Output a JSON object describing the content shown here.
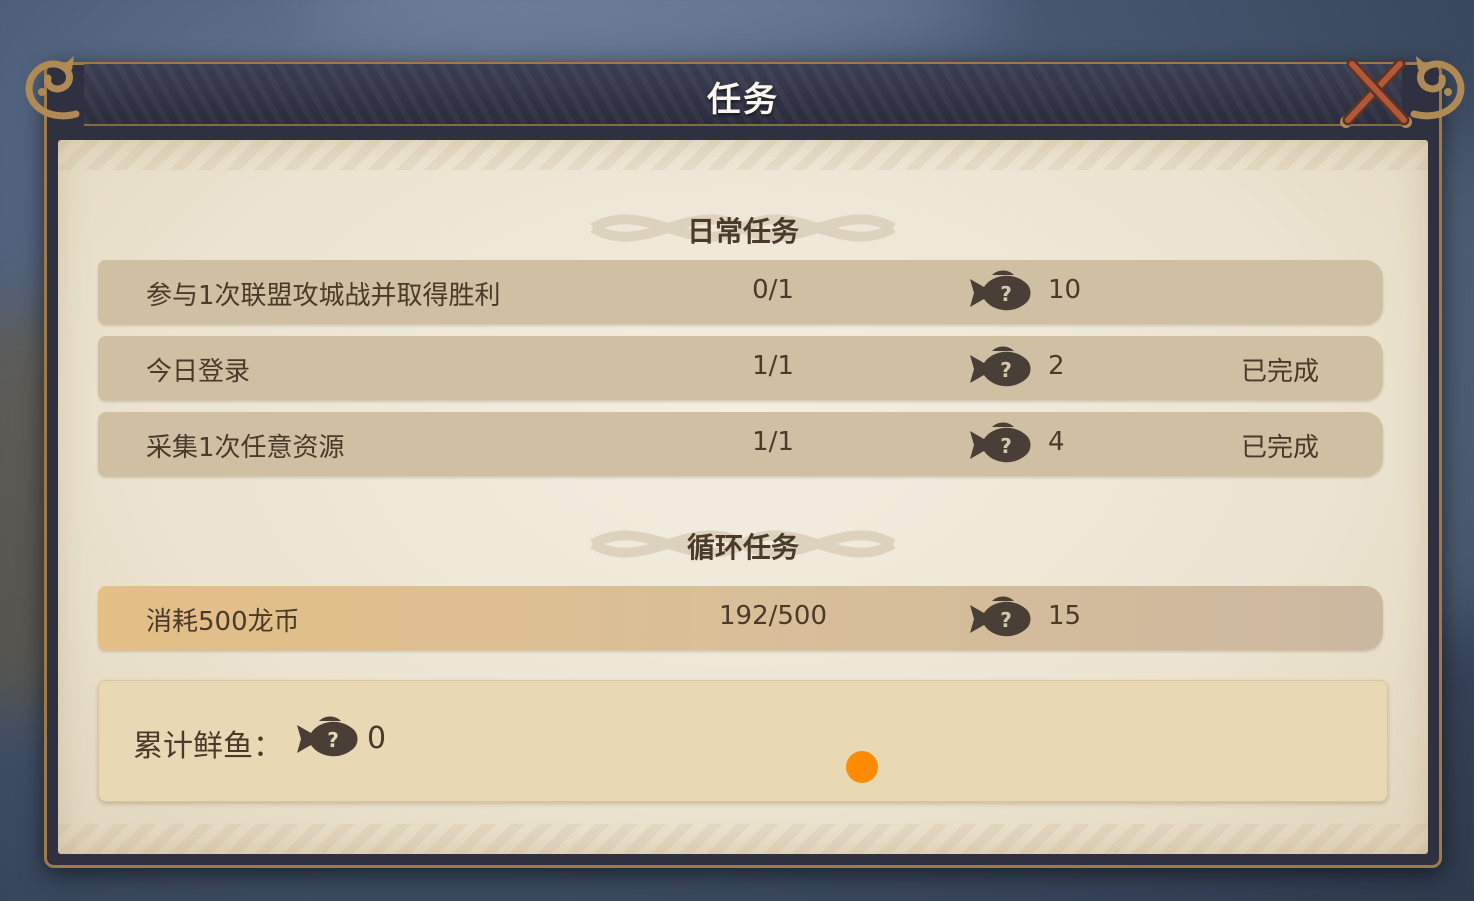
{
  "dialog": {
    "title": "任务"
  },
  "daily": {
    "header": "日常任务",
    "tasks": [
      {
        "name": "参与1次联盟攻城战并取得胜利",
        "progress": "0/1",
        "reward": "10",
        "status": ""
      },
      {
        "name": "今日登录",
        "progress": "1/1",
        "reward": "2",
        "status": "已完成"
      },
      {
        "name": "采集1次任意资源",
        "progress": "1/1",
        "reward": "4",
        "status": "已完成"
      }
    ]
  },
  "cycle": {
    "header": "循环任务",
    "tasks": [
      {
        "name": "消耗500龙币",
        "progress": "192/500",
        "reward": "15",
        "status": ""
      }
    ]
  },
  "total": {
    "label": "累计鲜鱼：",
    "value": "0"
  },
  "icons": {
    "reward": "mystery-fish-icon",
    "close": "close-x-icon",
    "ornament": "dragon-ornament-icon"
  },
  "colors": {
    "frame": "#2f3140",
    "frame_border": "#a0794a",
    "paper": "#ece4d1",
    "row": "#cfbfa3",
    "row_highlight": "#e4bf86",
    "text": "#4a3a2a",
    "touch_indicator": "#ff8c00"
  }
}
